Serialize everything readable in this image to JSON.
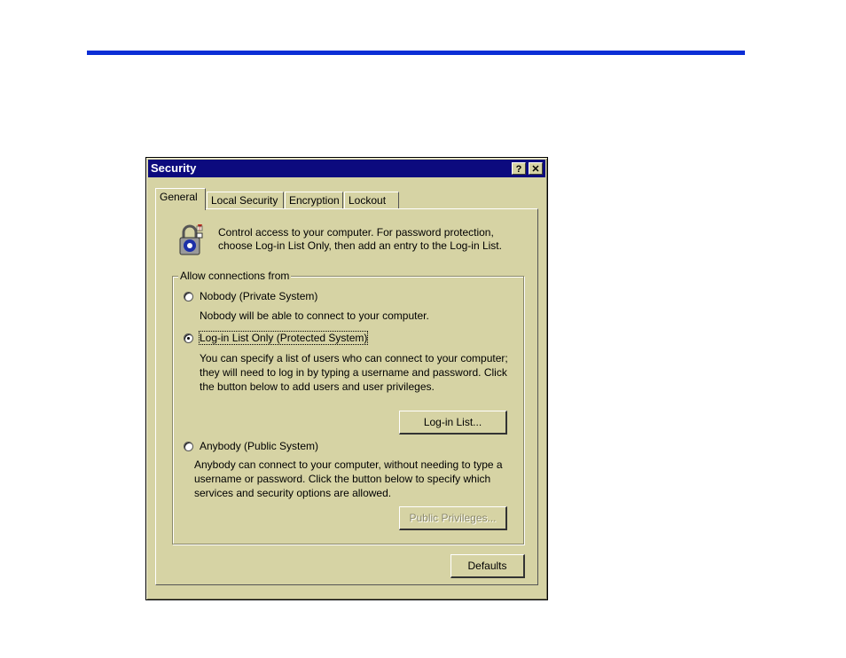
{
  "dialog": {
    "title": "Security",
    "help_label": "?",
    "close_label": "✕"
  },
  "tabs": [
    {
      "label": "General",
      "active": true
    },
    {
      "label": "Local Security",
      "active": false
    },
    {
      "label": "Encryption",
      "active": false
    },
    {
      "label": "Lockout",
      "active": false
    }
  ],
  "intro": "Control access to your computer.  For password protection, choose Log-in List Only, then add an entry to the Log-in List.",
  "group": {
    "label": "Allow connections from",
    "options": [
      {
        "label": "Nobody (Private System)",
        "selected": false,
        "description": "Nobody will be able to connect to your computer."
      },
      {
        "label": "Log-in List Only (Protected System)",
        "selected": true,
        "description": "You can specify a list of users who can connect to your computer; they will need to log in by typing a username and password.  Click the button below to add users and user privileges."
      },
      {
        "label": "Anybody (Public System)",
        "selected": false,
        "description": "Anybody can connect to your computer, without needing to type a username or password.  Click the button below to specify which services and security options are allowed."
      }
    ]
  },
  "buttons": {
    "login_list": "Log-in List...",
    "public_privileges": "Public Privileges...",
    "defaults": "Defaults"
  },
  "colors": {
    "slide_rule": "#0b2ed6",
    "titlebar": "#0c0a7e",
    "dialog_face": "#d6d3a4"
  }
}
